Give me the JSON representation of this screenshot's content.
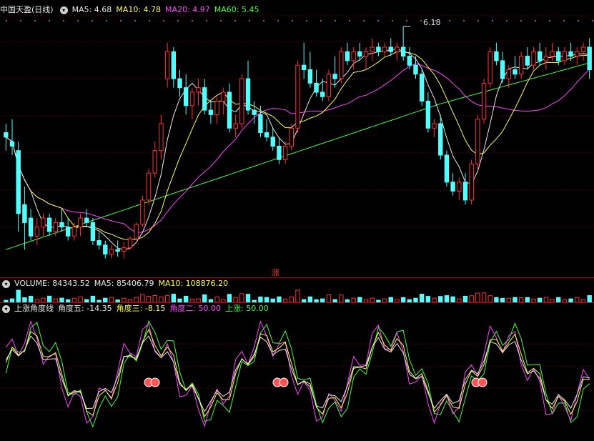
{
  "main_header": {
    "title": "中国天盈(日线)",
    "ma5": "MA5: 4.68",
    "ma10": "MA10: 4.78",
    "ma20": "MA20: 4.97",
    "ma60": "MA60: 5.45"
  },
  "max_label": "6.18",
  "zhang_label": "涨",
  "volume_header": {
    "volume": "VOLUME: 84343.52",
    "ma5": "MA5: 85406.79",
    "ma10": "MA10: 108876.20"
  },
  "indicator_header": {
    "name": "上涨角度线",
    "angle5": "角度五: -14.35",
    "angle3": "角度三: -8.15",
    "angle2": "角度二: 50.00",
    "up": "上涨: 50.00"
  },
  "colors": {
    "up": "#ff3333",
    "down": "#54ffff",
    "ma5": "#e8e8e8",
    "ma10": "#ffff55",
    "ma20": "#ff44ff",
    "ma60": "#44ff44",
    "grid": "#8a0000"
  },
  "chart_data": {
    "type": "candlestick",
    "price_range": [
      3.55,
      6.3
    ],
    "indicator_range": [
      -60,
      100
    ],
    "max_price": 6.18,
    "candles": [
      [
        5.0,
        5.1,
        4.8,
        4.95
      ],
      [
        4.9,
        5.15,
        4.75,
        4.85
      ],
      [
        4.8,
        4.9,
        3.9,
        4.1
      ],
      [
        4.2,
        4.4,
        3.7,
        4.0
      ],
      [
        4.05,
        4.15,
        3.8,
        3.85
      ],
      [
        3.85,
        4.05,
        3.75,
        3.95
      ],
      [
        3.95,
        4.1,
        3.85,
        4.05
      ],
      [
        4.05,
        4.1,
        3.85,
        3.9
      ],
      [
        3.9,
        4.05,
        3.85,
        4.0
      ],
      [
        4.0,
        4.15,
        3.9,
        3.95
      ],
      [
        3.95,
        4.05,
        3.8,
        3.85
      ],
      [
        3.85,
        4.0,
        3.8,
        3.95
      ],
      [
        3.95,
        4.1,
        3.85,
        4.05
      ],
      [
        4.05,
        4.15,
        3.95,
        4.0
      ],
      [
        4.0,
        4.05,
        3.75,
        3.8
      ],
      [
        3.8,
        3.9,
        3.7,
        3.75
      ],
      [
        3.75,
        3.8,
        3.6,
        3.65
      ],
      [
        3.65,
        3.75,
        3.6,
        3.7
      ],
      [
        3.7,
        3.8,
        3.62,
        3.68
      ],
      [
        3.68,
        3.78,
        3.6,
        3.72
      ],
      [
        3.72,
        3.85,
        3.7,
        3.82
      ],
      [
        3.82,
        4.0,
        3.8,
        3.98
      ],
      [
        3.98,
        4.3,
        3.95,
        4.25
      ],
      [
        4.25,
        4.6,
        4.2,
        4.55
      ],
      [
        4.55,
        4.9,
        4.5,
        4.8
      ],
      [
        4.8,
        5.2,
        4.7,
        5.1
      ],
      [
        5.6,
        6.0,
        5.5,
        5.9
      ],
      [
        5.9,
        5.95,
        5.5,
        5.6
      ],
      [
        5.6,
        5.7,
        5.4,
        5.5
      ],
      [
        5.5,
        5.65,
        5.2,
        5.3
      ],
      [
        5.3,
        5.5,
        5.15,
        5.45
      ],
      [
        5.45,
        5.6,
        5.3,
        5.5
      ],
      [
        5.5,
        5.6,
        5.2,
        5.25
      ],
      [
        5.25,
        5.35,
        5.1,
        5.2
      ],
      [
        5.2,
        5.4,
        5.1,
        5.35
      ],
      [
        5.35,
        5.5,
        5.2,
        5.45
      ],
      [
        5.45,
        5.55,
        5.0,
        5.05
      ],
      [
        5.05,
        5.2,
        4.95,
        5.1
      ],
      [
        5.1,
        5.65,
        5.05,
        5.6
      ],
      [
        5.6,
        5.8,
        5.2,
        5.25
      ],
      [
        5.25,
        5.35,
        5.1,
        5.2
      ],
      [
        5.2,
        5.3,
        4.95,
        5.0
      ],
      [
        5.0,
        5.15,
        4.9,
        4.95
      ],
      [
        4.95,
        5.05,
        4.8,
        4.85
      ],
      [
        4.85,
        4.95,
        4.65,
        4.7
      ],
      [
        4.7,
        4.9,
        4.65,
        4.85
      ],
      [
        4.85,
        5.1,
        4.8,
        5.05
      ],
      [
        5.05,
        5.8,
        5.0,
        5.75
      ],
      [
        5.75,
        6.0,
        5.6,
        5.7
      ],
      [
        5.7,
        5.9,
        5.5,
        5.55
      ],
      [
        5.55,
        5.7,
        5.4,
        5.45
      ],
      [
        5.45,
        5.6,
        5.35,
        5.4
      ],
      [
        5.4,
        5.7,
        5.35,
        5.65
      ],
      [
        5.65,
        5.85,
        5.5,
        5.6
      ],
      [
        5.6,
        5.95,
        5.55,
        5.9
      ],
      [
        5.9,
        6.0,
        5.75,
        5.8
      ],
      [
        5.8,
        5.95,
        5.7,
        5.9
      ],
      [
        5.9,
        6.0,
        5.8,
        5.85
      ],
      [
        5.85,
        5.95,
        5.7,
        5.9
      ],
      [
        5.9,
        6.05,
        5.8,
        5.95
      ],
      [
        5.95,
        6.0,
        5.85,
        5.9
      ],
      [
        5.9,
        6.0,
        5.85,
        5.95
      ],
      [
        5.95,
        6.05,
        5.85,
        5.9
      ],
      [
        5.9,
        6.0,
        5.8,
        5.95
      ],
      [
        5.95,
        6.18,
        5.8,
        5.85
      ],
      [
        5.85,
        5.95,
        5.7,
        5.75
      ],
      [
        5.75,
        5.85,
        5.6,
        5.65
      ],
      [
        5.65,
        5.7,
        5.3,
        5.35
      ],
      [
        5.35,
        5.45,
        5.0,
        5.05
      ],
      [
        5.05,
        5.15,
        4.95,
        5.1
      ],
      [
        5.1,
        5.2,
        4.7,
        4.75
      ],
      [
        4.75,
        4.8,
        4.4,
        4.45
      ],
      [
        4.45,
        4.55,
        4.3,
        4.35
      ],
      [
        4.35,
        4.5,
        4.25,
        4.45
      ],
      [
        4.45,
        4.55,
        4.2,
        4.25
      ],
      [
        4.25,
        4.7,
        4.2,
        4.65
      ],
      [
        4.65,
        5.2,
        4.6,
        5.15
      ],
      [
        5.15,
        5.6,
        5.1,
        5.55
      ],
      [
        5.55,
        5.95,
        5.5,
        5.9
      ],
      [
        5.9,
        6.0,
        5.75,
        5.8
      ],
      [
        5.8,
        5.9,
        5.55,
        5.6
      ],
      [
        5.6,
        5.75,
        5.5,
        5.7
      ],
      [
        5.7,
        5.85,
        5.6,
        5.65
      ],
      [
        5.65,
        5.9,
        5.6,
        5.85
      ],
      [
        5.85,
        5.95,
        5.7,
        5.75
      ],
      [
        5.75,
        5.95,
        5.7,
        5.9
      ],
      [
        5.9,
        6.0,
        5.75,
        5.8
      ],
      [
        5.8,
        5.95,
        5.7,
        5.85
      ],
      [
        5.85,
        6.0,
        5.8,
        5.9
      ],
      [
        5.9,
        5.95,
        5.75,
        5.8
      ],
      [
        5.8,
        5.95,
        5.75,
        5.9
      ],
      [
        5.9,
        6.0,
        5.8,
        5.85
      ],
      [
        5.85,
        5.95,
        5.75,
        5.9
      ],
      [
        5.9,
        6.0,
        5.8,
        5.95
      ],
      [
        5.95,
        6.05,
        5.6,
        5.7
      ]
    ]
  }
}
